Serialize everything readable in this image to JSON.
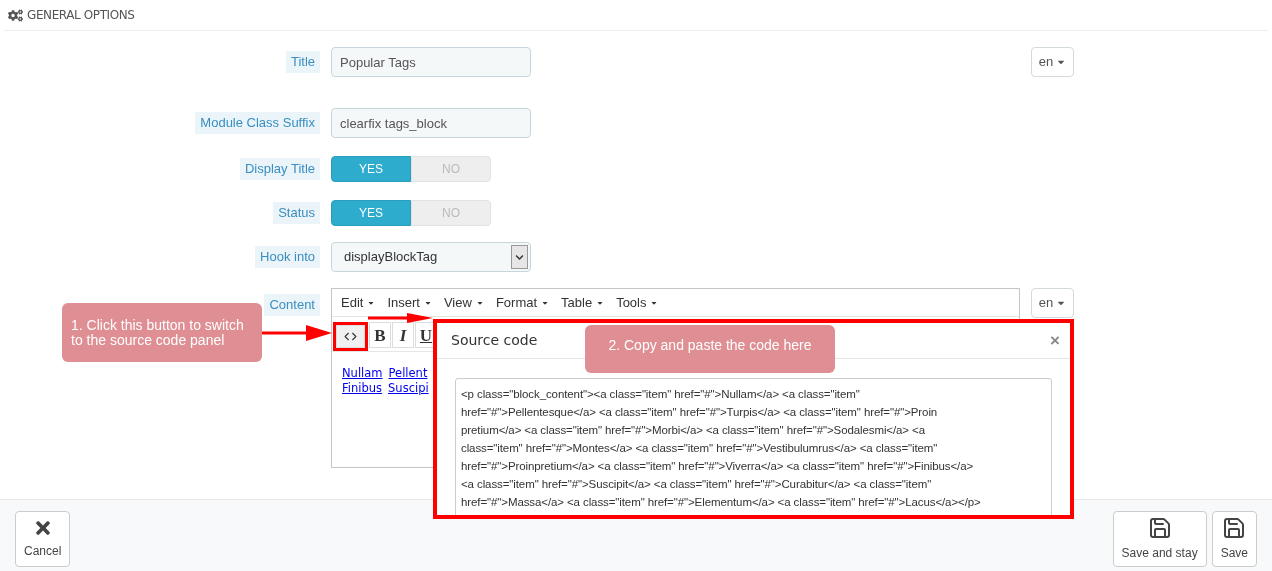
{
  "header": {
    "title": "GENERAL OPTIONS"
  },
  "fields": [
    {
      "kind": "text",
      "label": "Title",
      "value": "Popular Tags",
      "language": "en"
    },
    {
      "kind": "text",
      "label": "Module Class Suffix",
      "value": "clearfix tags_block"
    },
    {
      "kind": "toggle",
      "label": "Display Title",
      "options": [
        {
          "label": "YES",
          "selected": true
        },
        {
          "label": "NO",
          "selected": false
        }
      ]
    },
    {
      "kind": "toggle",
      "label": "Status",
      "options": [
        {
          "label": "YES",
          "selected": true
        },
        {
          "label": "NO",
          "selected": false
        }
      ]
    },
    {
      "kind": "select",
      "label": "Hook into",
      "value": "displayBlockTag"
    },
    {
      "kind": "editor",
      "label": "Content",
      "language": "en",
      "menus": [
        "Edit",
        "Insert",
        "View",
        "Format",
        "Table",
        "Tools"
      ],
      "toolbar": [
        "B",
        "I",
        "U"
      ],
      "link_lines": [
        [
          "Nullam",
          "Pellent"
        ],
        [
          "Finibus",
          "Suscipi"
        ]
      ]
    }
  ],
  "source_dialog": {
    "title": "Source code",
    "close": "×",
    "code_lines": [
      "<p class=\"block_content\"><a class=\"item\" href=\"#\">Nullam</a> <a class=\"item\"",
      "href=\"#\">Pellentesque</a> <a class=\"item\" href=\"#\">Turpis</a> <a class=\"item\" href=\"#\">Proin",
      "pretium</a> <a class=\"item\" href=\"#\">Morbi</a> <a class=\"item\" href=\"#\">Sodalesmi</a> <a",
      "class=\"item\" href=\"#\">Montes</a> <a class=\"item\" href=\"#\">Vestibulumrus</a> <a class=\"item\"",
      "href=\"#\">Proinpretium</a> <a class=\"item\" href=\"#\">Viverra</a> <a class=\"item\" href=\"#\">Finibus</a>",
      "<a class=\"item\" href=\"#\">Suscipit</a> <a class=\"item\" href=\"#\">Curabitur</a> <a class=\"item\"",
      "href=\"#\">Massa</a> <a class=\"item\" href=\"#\">Elementum</a> <a class=\"item\" href=\"#\">Lacus</a></p>"
    ]
  },
  "callouts": [
    {
      "text": "1. Click this button to switch to the source code panel"
    },
    {
      "text": "2. Copy and paste the code here"
    }
  ],
  "footer": {
    "buttons": [
      {
        "kind": "cancel",
        "label": "Cancel"
      },
      {
        "kind": "save",
        "label": "Save and stay"
      },
      {
        "kind": "save",
        "label": "Save"
      }
    ]
  }
}
